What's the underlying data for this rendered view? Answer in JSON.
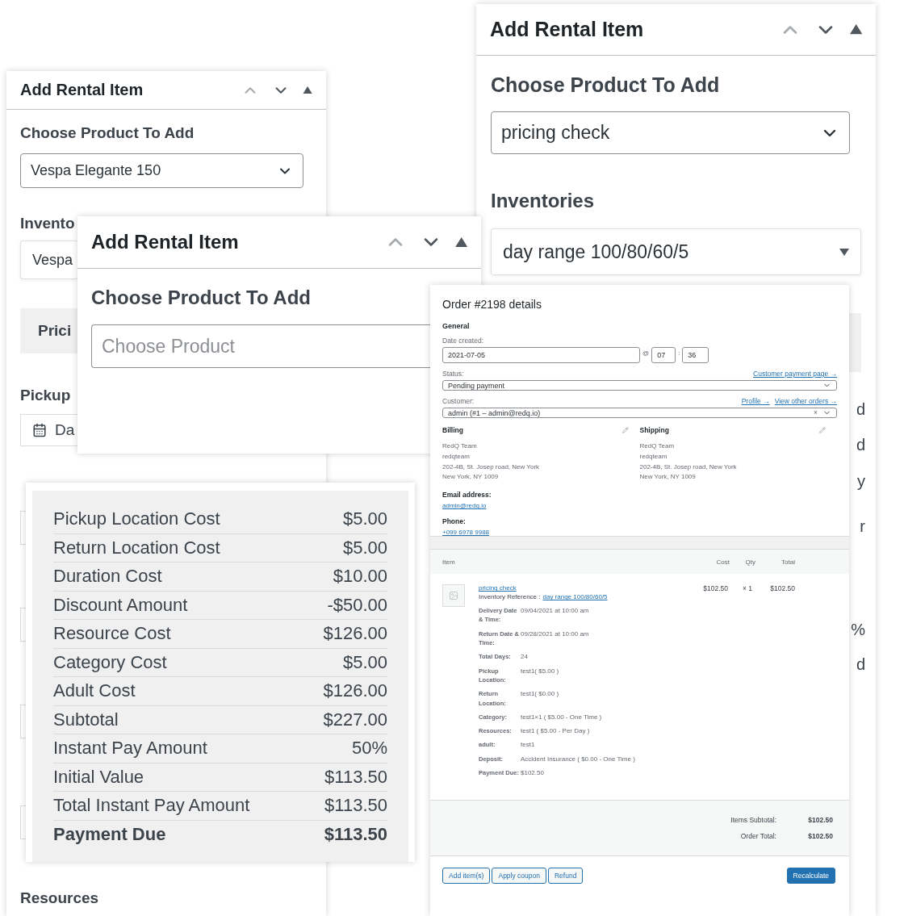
{
  "back_panel": {
    "title": "Add Rental Item",
    "product_label": "Choose Product To Add",
    "product_value": "Vespa Elegante 150",
    "inventory_label": "Invento",
    "inventory_value": "Vespa",
    "pricing_label": "Prici",
    "pickup_label": "Pickup",
    "pickup_date": "Da",
    "resources_label": "Resources"
  },
  "right_panel": {
    "title": "Add Rental Item",
    "product_label": "Choose Product To Add",
    "product_value": "pricing check",
    "inventory_label": "Inventories",
    "inventory_value": "day range 100/80/60/5",
    "cut_texts": [
      "d",
      "d",
      "y",
      "r",
      "%",
      "d"
    ]
  },
  "middle_panel": {
    "title": "Add Rental Item",
    "product_label": "Choose Product To Add",
    "product_placeholder": "Choose Product"
  },
  "cost_summary": {
    "rows": [
      {
        "kind": "line",
        "label": "Pickup Location Cost",
        "value": "$5.00"
      },
      {
        "kind": "line",
        "label": "Return Location Cost",
        "value": "$5.00"
      },
      {
        "kind": "line",
        "label": "Duration Cost",
        "value": "$10.00"
      },
      {
        "kind": "line",
        "label": "Discount Amount",
        "value": "-$50.00"
      },
      {
        "kind": "line",
        "label": "Resource Cost",
        "value": "$126.00"
      },
      {
        "kind": "line",
        "label": "Category Cost",
        "value": "$5.00"
      },
      {
        "kind": "line",
        "label": "Adult Cost",
        "value": "$126.00"
      },
      {
        "kind": "line",
        "label": "Subtotal",
        "value": "$227.00"
      },
      {
        "kind": "line",
        "label": "Instant Pay Amount",
        "value": "50%"
      },
      {
        "kind": "line",
        "label": "Initial Value",
        "value": "$113.50"
      },
      {
        "kind": "line",
        "label": "Total Instant Pay Amount",
        "value": "$113.50"
      },
      {
        "kind": "total",
        "label": "Payment Due",
        "value": "$113.50"
      }
    ]
  },
  "order": {
    "title": "Order #2198 details",
    "general_heading": "General",
    "date_label": "Date created:",
    "date": "2021-07-05",
    "at": "@",
    "hour": "07",
    "colon": ":",
    "minute": "36",
    "status_label": "Status:",
    "payment_link": "Customer payment page →",
    "status": "Pending payment",
    "customer_label": "Customer:",
    "profile_link": "Profile →",
    "other_orders_link": "View other orders →",
    "customer": "admin (#1 – admin@redq.io)",
    "clear": "×",
    "addresses": [
      {
        "heading": "Billing",
        "lines": [
          "RedQ Team",
          "redqteam",
          "202-4B, St. Josep road, New York",
          "New York, NY 1009"
        ]
      },
      {
        "heading": "Shipping",
        "lines": [
          "RedQ Team",
          "redqteam",
          "202-4B, St. Josep road, New York",
          "New York, NY 1009"
        ]
      }
    ],
    "email_label": "Email address:",
    "email": "admin@redq.io",
    "phone_label": "Phone:",
    "phone": "+099 6978 9988",
    "columns": [
      "Item",
      "Cost",
      "Qty",
      "Total"
    ],
    "item": {
      "name": "pricing check",
      "reference_label": "Inventory Reference :",
      "reference": "day range 100/80/60/5",
      "cost": "$102.50",
      "qty": "× 1",
      "total": "$102.50",
      "meta": [
        {
          "label": "Delivery Date & Time:",
          "value": "09/04/2021 at 10:00 am"
        },
        {
          "label": "Return Date & Time:",
          "value": "09/28/2021 at 10:00 am"
        },
        {
          "label": "Total Days:",
          "value": "24"
        },
        {
          "label": "Pickup Location:",
          "value": "test1( $5.00 )"
        },
        {
          "label": "Return Location:",
          "value": "test1( $0.00 )"
        },
        {
          "label": "Category:",
          "value": "test1×1 ( $5.00 - One Time )"
        },
        {
          "label": "Resources:",
          "value": "test1 ( $5.00 - Per Day )"
        },
        {
          "label": "adult:",
          "value": "test1"
        },
        {
          "label": "Deposit:",
          "value": "Accident Insurance ( $0.00 - One Time )"
        },
        {
          "label": "Payment Due:",
          "value": "$102.50"
        }
      ]
    },
    "totals": [
      {
        "label": "Items Subtotal:",
        "value": "$102.50"
      },
      {
        "label": "Order Total:",
        "value": "$102.50"
      }
    ],
    "buttons": [
      {
        "kind": "outline",
        "label": "Add item(s)"
      },
      {
        "kind": "outline",
        "label": "Apply coupon"
      },
      {
        "kind": "outline",
        "label": "Refund"
      },
      {
        "kind": "primary",
        "label": "Recalculate"
      }
    ]
  }
}
